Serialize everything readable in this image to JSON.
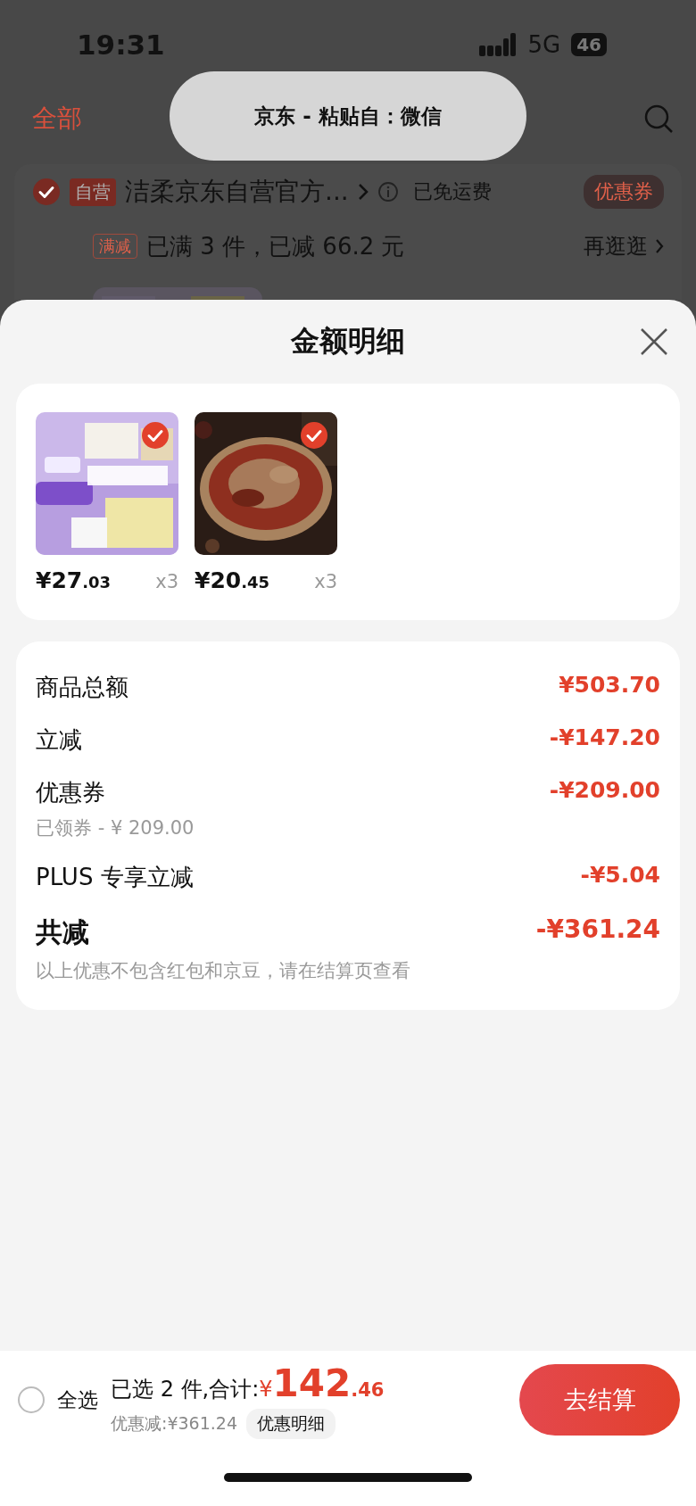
{
  "status_bar": {
    "time": "19:31",
    "network": "5G",
    "battery": "46"
  },
  "header": {
    "tab": "全部"
  },
  "toast": {
    "text": "京东 - 粘贴自：微信"
  },
  "store": {
    "checked": true,
    "tag": "自营",
    "name": "洁柔京东自营官方...",
    "shipping": "已免运费",
    "coupon": "优惠券"
  },
  "promo": {
    "tag": "满减",
    "text": "已满 3 件，已减 66.2 元",
    "link": "再逛逛"
  },
  "sheet": {
    "title": "金额明细",
    "items": [
      {
        "kind": "tissue",
        "checked": true,
        "price": "¥27",
        "cents": ".03",
        "qty": "x3"
      },
      {
        "kind": "food",
        "checked": true,
        "price": "¥20",
        "cents": ".45",
        "qty": "x3"
      }
    ],
    "breakdown": [
      {
        "kind": "normal",
        "label": "商品总额",
        "value": "¥503.70"
      },
      {
        "kind": "normal",
        "label": "立减",
        "value": "-¥147.20"
      },
      {
        "kind": "normal",
        "label": "优惠券",
        "value": "-¥209.00",
        "note": "已领券 - ¥ 209.00"
      },
      {
        "kind": "normal",
        "label": "PLUS 专享立减",
        "value": "-¥5.04"
      },
      {
        "kind": "total",
        "label": "共减",
        "value": "-¥361.24"
      }
    ],
    "disclaimer": "以上优惠不包含红包和京豆，请在结算页查看"
  },
  "bottom_bar": {
    "select_all": {
      "label": "全选",
      "checked": false
    },
    "summary": "已选 2 件,合计:",
    "currency": "¥",
    "total": "142",
    "cents": ".46",
    "discount": "优惠减:¥361.24",
    "detail_button": "优惠明细",
    "checkout": "去结算"
  }
}
